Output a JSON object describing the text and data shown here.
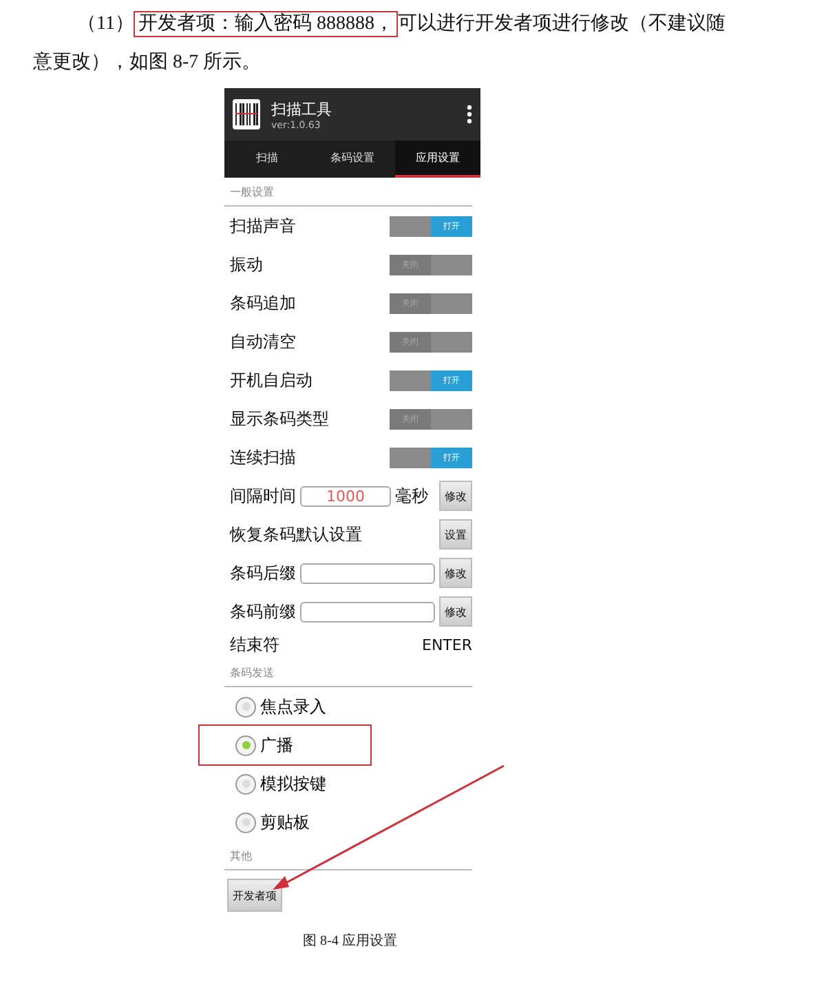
{
  "paragraph": {
    "number": "（11）",
    "highlighted_text": "开发者项：输入密码 888888，",
    "text": "可以进行开发者项进行修改（不建议随意更改），如图 8-7 所示。"
  },
  "app": {
    "title": "扫描工具",
    "version": "ver:1.0.63",
    "tabs": [
      {
        "label": "扫描",
        "selected": false
      },
      {
        "label": "条码设置",
        "selected": false
      },
      {
        "label": "应用设置",
        "selected": true
      }
    ],
    "sections": [
      {
        "title": "一般设置",
        "items": [
          {
            "kind": "toggle",
            "label": "扫描声音",
            "on": true,
            "state_text": "打开"
          },
          {
            "kind": "toggle",
            "label": "振动",
            "on": false,
            "state_text": "关闭"
          },
          {
            "kind": "toggle",
            "label": "条码追加",
            "on": false,
            "state_text": "关闭"
          },
          {
            "kind": "toggle",
            "label": "自动清空",
            "on": false,
            "state_text": "关闭"
          },
          {
            "kind": "toggle",
            "label": "开机自启动",
            "on": true,
            "state_text": "打开"
          },
          {
            "kind": "toggle",
            "label": "显示条码类型",
            "on": false,
            "state_text": "关闭"
          },
          {
            "kind": "toggle",
            "label": "连续扫描",
            "on": true,
            "state_text": "打开"
          },
          {
            "kind": "number",
            "label": "间隔时间",
            "value": "1000",
            "unit": "毫秒",
            "button": "修改"
          },
          {
            "kind": "action",
            "label": "恢复条码默认设置",
            "button": "设置"
          },
          {
            "kind": "text",
            "label": "条码后缀",
            "button": "修改"
          },
          {
            "kind": "text",
            "label": "条码前缀",
            "button": "修改"
          },
          {
            "kind": "value",
            "label": "结束符",
            "value": "ENTER"
          }
        ]
      },
      {
        "title": "条码发送",
        "items": [
          {
            "kind": "radio",
            "label": "焦点录入",
            "selected": false,
            "highlighted": false
          },
          {
            "kind": "radio",
            "label": "广播",
            "selected": true,
            "highlighted": true
          },
          {
            "kind": "radio",
            "label": "模拟按键",
            "selected": false,
            "highlighted": false
          },
          {
            "kind": "radio",
            "label": "剪贴板",
            "selected": false,
            "highlighted": false
          }
        ]
      },
      {
        "title": "其他",
        "items": [
          {
            "kind": "button",
            "label": "开发者项",
            "pointed": true
          }
        ]
      }
    ]
  },
  "caption": "图 8-4 应用设置"
}
